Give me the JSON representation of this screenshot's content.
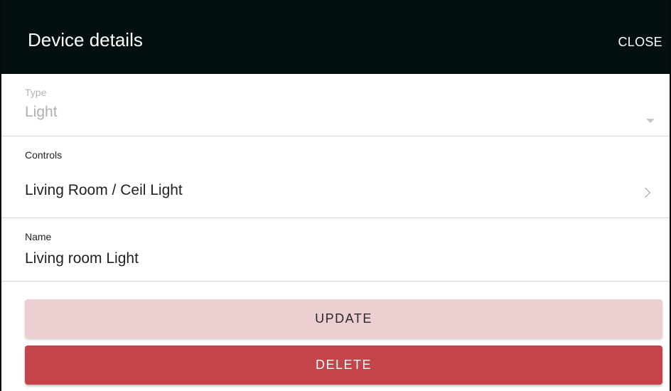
{
  "header": {
    "title": "Device details",
    "close_label": "CLOSE",
    "background_color": "#03100f"
  },
  "type_field": {
    "label": "Type",
    "value": "Light",
    "disabled": true,
    "icon": "dropdown-arrow-icon"
  },
  "controls_field": {
    "label": "Controls",
    "value": "Living Room / Ceil Light",
    "icon": "chevron-right-icon"
  },
  "name_field": {
    "label": "Name",
    "value": "Living room Light"
  },
  "actions": {
    "update_label": "UPDATE",
    "update_color": "#ebcfd1",
    "delete_label": "DELETE",
    "delete_color": "#c3454a"
  }
}
